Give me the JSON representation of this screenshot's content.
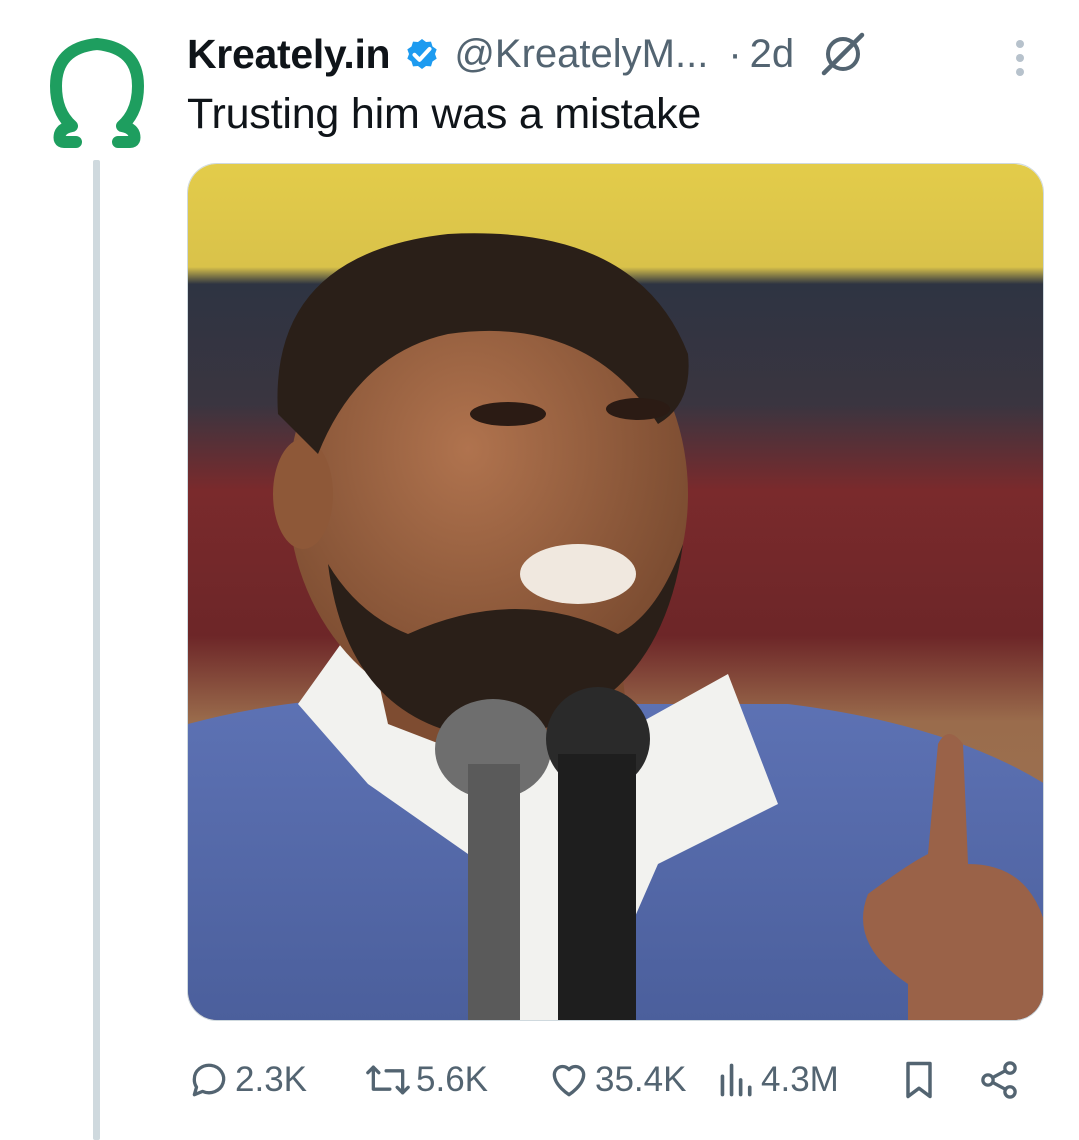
{
  "author": {
    "name": "Kreately.in",
    "handle": "@KreatelyM...",
    "separator": "·",
    "time": "2d",
    "avatar_icon": "omega-logo-icon",
    "verified_icon": "verified-badge-icon"
  },
  "tweet": {
    "text": "Trusting him was a mistake",
    "media_description": "photo-of-man-speaking-into-microphones"
  },
  "actions": {
    "replies": "2.3K",
    "reposts": "5.6K",
    "likes": "35.4K",
    "views": "4.3M"
  },
  "colors": {
    "brand_green": "#1e9e5f",
    "verified_blue": "#1d9bf0",
    "muted_text": "#536471",
    "thread_line": "#cfd9de"
  }
}
